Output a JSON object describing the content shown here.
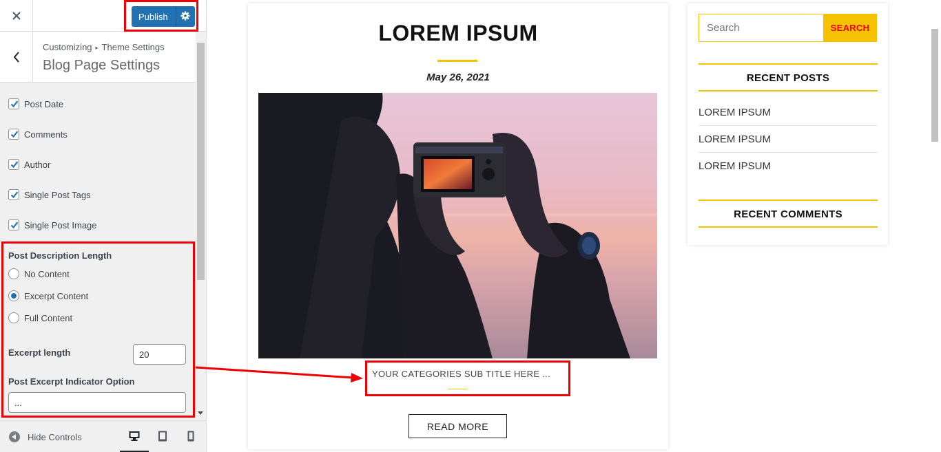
{
  "customizer": {
    "publish_label": "Publish",
    "breadcrumb_root": "Customizing",
    "breadcrumb_parent": "Theme Settings",
    "section_title": "Blog Page Settings",
    "checkboxes": [
      {
        "label": "Post Date",
        "checked": true
      },
      {
        "label": "Comments",
        "checked": true
      },
      {
        "label": "Author",
        "checked": true
      },
      {
        "label": "Single Post Tags",
        "checked": true
      },
      {
        "label": "Single Post Image",
        "checked": true
      }
    ],
    "description_length": {
      "label": "Post Description Length",
      "options": [
        "No Content",
        "Excerpt Content",
        "Full Content"
      ],
      "selected": "Excerpt Content"
    },
    "excerpt_length": {
      "label": "Excerpt length",
      "value": "20"
    },
    "excerpt_indicator": {
      "label": "Post Excerpt Indicator Option",
      "value": "..."
    },
    "footer": {
      "hide_controls": "Hide Controls"
    }
  },
  "preview": {
    "post_title": "LOREM IPSUM",
    "post_date": "May 26, 2021",
    "category_subtitle": "YOUR CATEGORIES SUB TITLE HERE ...",
    "read_more": "READ MORE",
    "search": {
      "placeholder": "Search",
      "button": "SEARCH"
    },
    "recent_posts": {
      "title": "RECENT POSTS",
      "items": [
        "LOREM IPSUM",
        "LOREM IPSUM",
        "LOREM IPSUM"
      ]
    },
    "recent_comments": {
      "title": "RECENT COMMENTS"
    }
  },
  "colors": {
    "accent": "#f5c200",
    "publish": "#2271b1",
    "highlight": "#ee0000"
  },
  "icons": [
    "close-icon",
    "gear-icon",
    "chevron-left-icon",
    "checkmark-icon",
    "desktop-icon",
    "tablet-icon",
    "mobile-icon"
  ]
}
